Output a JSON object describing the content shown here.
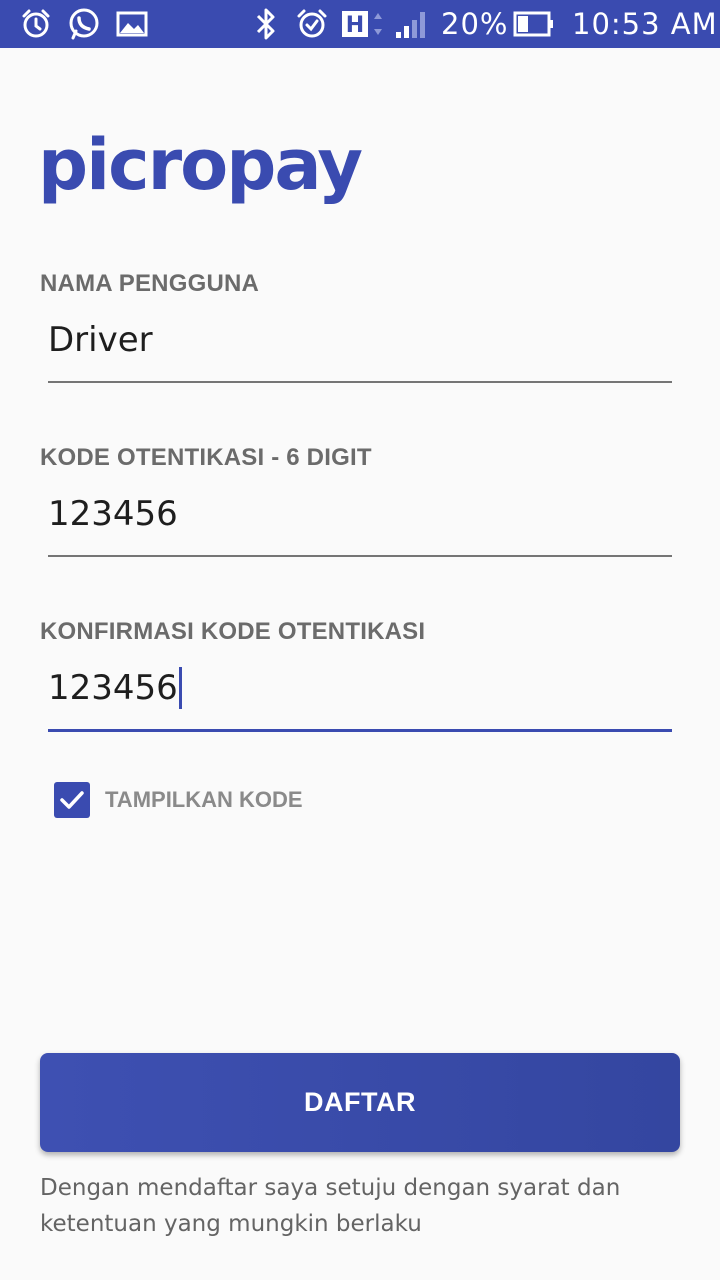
{
  "status_bar": {
    "battery_percent": "20%",
    "time": "10:53 AM",
    "network_type": "H",
    "icons": [
      "alarm-icon",
      "whatsapp-icon",
      "gallery-icon",
      "bluetooth-icon",
      "alarm-clock-icon",
      "network-h-icon",
      "signal-icon",
      "battery-icon"
    ]
  },
  "app": {
    "logo_text": "picropay",
    "accent_color": "#3a4bb0"
  },
  "form": {
    "username_label": "NAMA PENGGUNA",
    "username_value": "Driver",
    "code_label": "KODE OTENTIKASI - 6 DIGIT",
    "code_value": "123456",
    "confirm_label": "KONFIRMASI KODE OTENTIKASI",
    "confirm_value": "123456",
    "show_code_label": "TAMPILKAN KODE",
    "show_code_checked": true
  },
  "actions": {
    "register_label": "DAFTAR"
  },
  "footer": {
    "terms_line1": "Dengan mendaftar saya setuju dengan syarat dan",
    "terms_line2": "ketentuan yang mungkin berlaku"
  }
}
